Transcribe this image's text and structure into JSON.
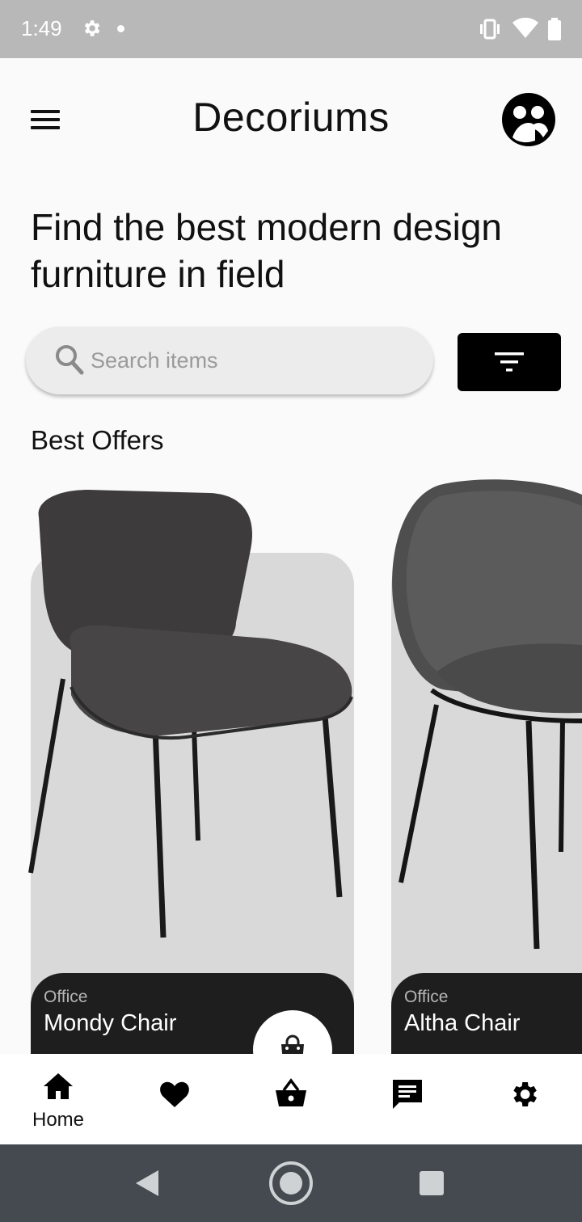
{
  "status_bar": {
    "time": "1:49",
    "icons": [
      "gear-icon",
      "dot-icon",
      "vibrate-icon",
      "wifi-icon",
      "battery-icon"
    ]
  },
  "app_bar": {
    "title": "Decoriums",
    "menu_icon": "hamburger-menu-icon",
    "avatar_icon": "user-avatar-icon"
  },
  "headline": "Find the best modern design furniture in field",
  "search": {
    "placeholder": "Search items",
    "value": ""
  },
  "filter_icon": "filter-icon",
  "section_title": "Best Offers",
  "products": [
    {
      "category": "Office",
      "name": "Mondy Chair"
    },
    {
      "category": "Office",
      "name": "Altha Chair"
    }
  ],
  "bottom_nav": {
    "items": [
      {
        "label": "Home",
        "icon": "home-icon",
        "active": true
      },
      {
        "label": "",
        "icon": "heart-icon"
      },
      {
        "label": "",
        "icon": "basket-icon"
      },
      {
        "label": "",
        "icon": "chat-icon"
      },
      {
        "label": "",
        "icon": "settings-icon"
      }
    ]
  },
  "colors": {
    "background": "#fafafa",
    "accent": "#000000",
    "card_bg": "#d9d9d9",
    "card_info_bg": "#1e1e1e",
    "status_bar": "#b8b8b8",
    "system_nav": "#444a50"
  }
}
